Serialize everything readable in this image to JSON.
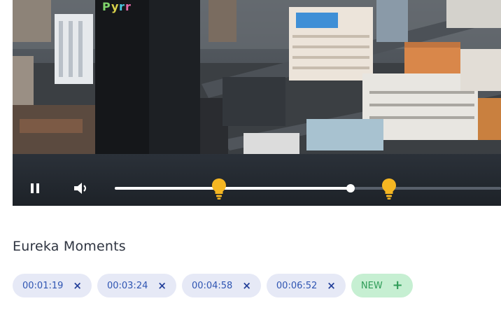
{
  "video": {
    "progress": 0.61,
    "markers": [
      0.27,
      0.71
    ],
    "building_sign_text": "Pyrr"
  },
  "controls": {
    "pause_icon": "pause-icon",
    "volume_icon": "volume-icon",
    "marker_icon": "lightbulb-icon"
  },
  "eureka": {
    "heading": "Eureka Moments",
    "moments": [
      {
        "time": "00:01:19",
        "remove": "×"
      },
      {
        "time": "00:03:24",
        "remove": "×"
      },
      {
        "time": "00:04:58",
        "remove": "×"
      },
      {
        "time": "00:06:52",
        "remove": "×"
      }
    ],
    "new_label": "NEW",
    "new_icon": "+"
  },
  "colors": {
    "chip_bg": "#e6e9f6",
    "chip_text": "#2f55b2",
    "new_bg": "#c6efd2",
    "new_text": "#2f9c58",
    "marker": "#f5b622"
  }
}
